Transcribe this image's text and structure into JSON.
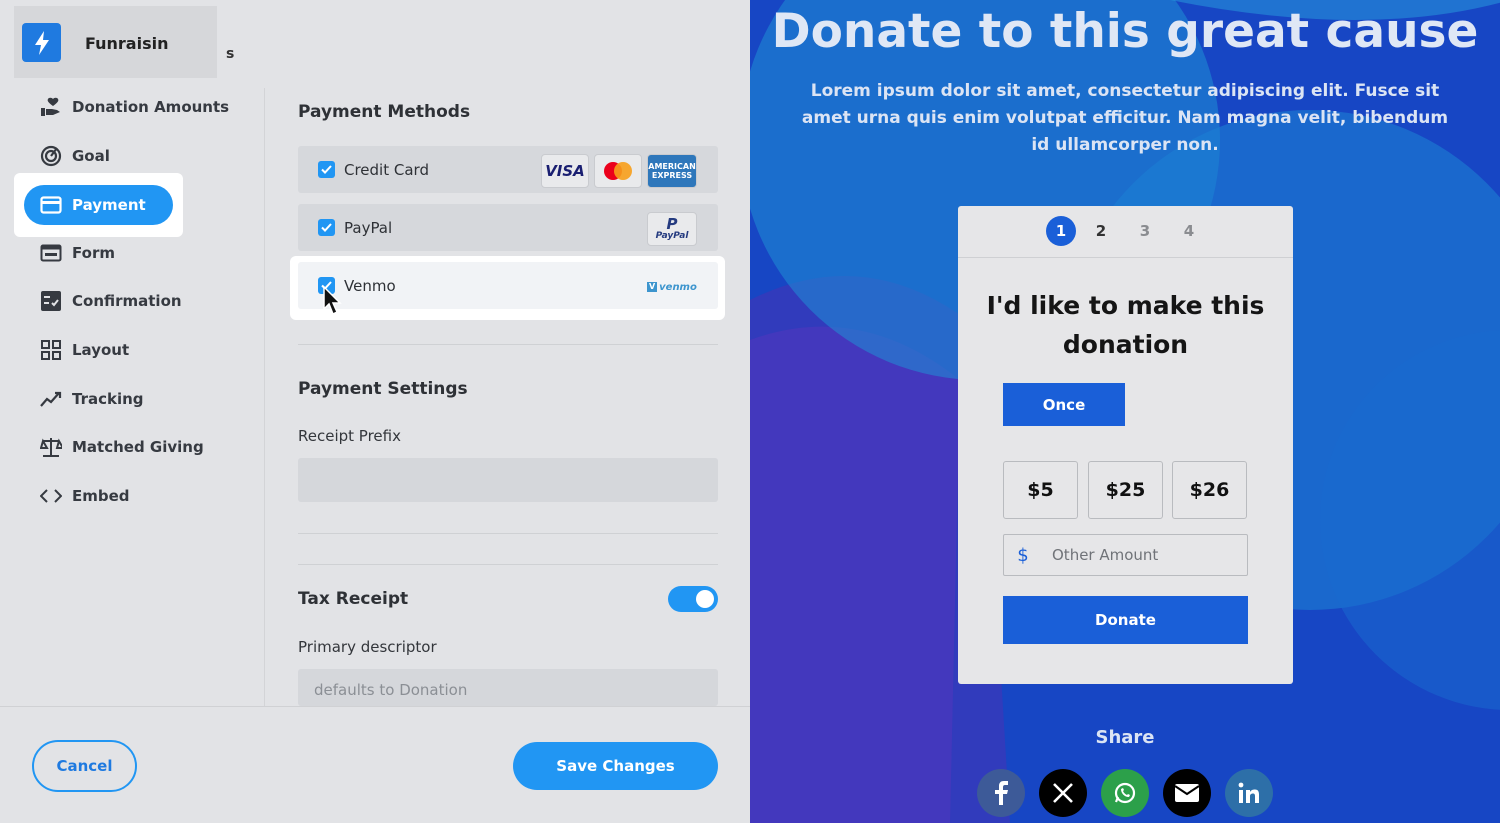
{
  "brand": {
    "name": "Funraisin",
    "tail": "s"
  },
  "nav": {
    "items": [
      {
        "label": "Donation Amounts"
      },
      {
        "label": "Goal"
      },
      {
        "label": "Payment"
      },
      {
        "label": "Form"
      },
      {
        "label": "Confirmation"
      },
      {
        "label": "Layout"
      },
      {
        "label": "Tracking"
      },
      {
        "label": "Matched Giving"
      },
      {
        "label": "Embed"
      }
    ],
    "active": "Payment"
  },
  "payment_methods": {
    "heading": "Payment Methods",
    "items": [
      {
        "label": "Credit Card",
        "checked": true,
        "cards": [
          "VISA",
          "mastercard",
          "AMERICAN EXPRESS"
        ]
      },
      {
        "label": "PayPal",
        "checked": true,
        "logo": "PayPal"
      },
      {
        "label": "Venmo",
        "checked": true,
        "logo": "venmo"
      }
    ]
  },
  "payment_settings": {
    "heading": "Payment Settings",
    "receipt_prefix_label": "Receipt Prefix",
    "receipt_prefix_value": ""
  },
  "tax_receipt": {
    "heading": "Tax Receipt",
    "enabled": true,
    "primary_descriptor_label": "Primary descriptor",
    "primary_descriptor_placeholder": "defaults to Donation"
  },
  "footer": {
    "cancel_label": "Cancel",
    "save_label": "Save Changes"
  },
  "preview": {
    "title": "Donate to this great cause",
    "subtitle": "Lorem ipsum dolor sit amet, consectetur adipiscing elit. Fusce sit amet urna quis enim volutpat efficitur. Nam magna velit, bibendum id ullamcorper non.",
    "steps": [
      "1",
      "2",
      "3",
      "4"
    ],
    "active_step": "1",
    "heading": "I'd like to make this donation",
    "frequency": "Once",
    "amounts": [
      "$5",
      "$25",
      "$26"
    ],
    "currency_symbol": "$",
    "other_placeholder": "Other Amount",
    "donate_label": "Donate",
    "share_label": "Share",
    "social": [
      "facebook",
      "x",
      "whatsapp",
      "email",
      "linkedin"
    ]
  },
  "colors": {
    "accent": "#2196f3",
    "preview_bg": "#1746c4",
    "widget_button": "#1a5fd8"
  }
}
